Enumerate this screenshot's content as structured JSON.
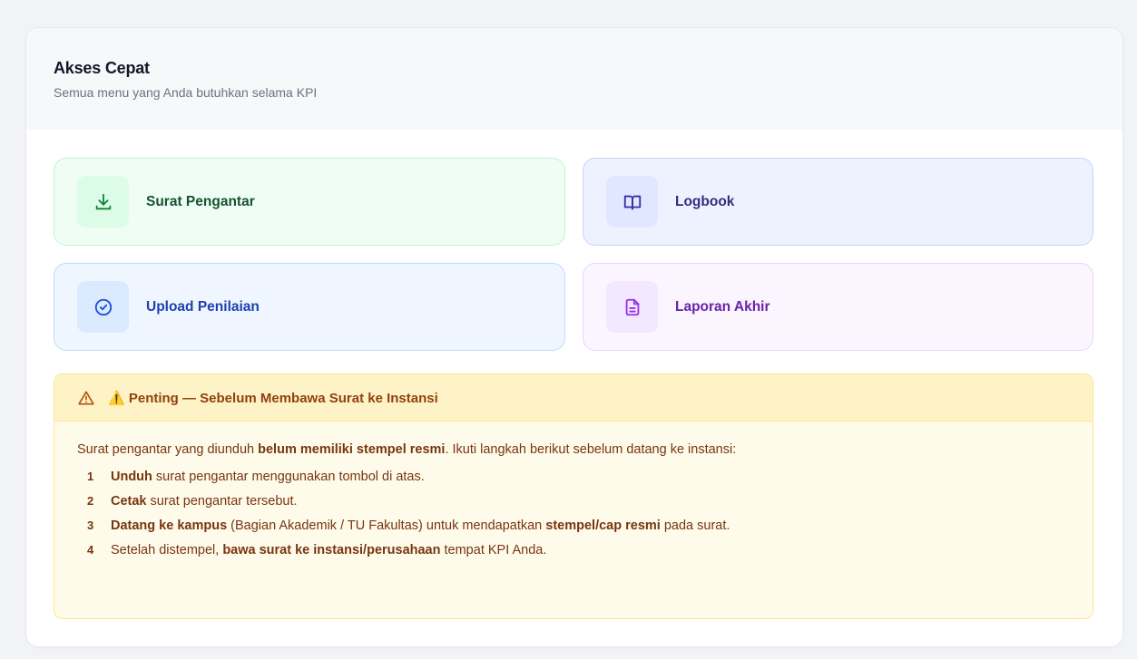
{
  "header": {
    "title": "Akses Cepat",
    "subtitle": "Semua menu yang Anda butuhkan selama KPI"
  },
  "tiles": [
    {
      "label": "Surat Pengantar",
      "icon": "download-icon",
      "color": "#15803d"
    },
    {
      "label": "Logbook",
      "icon": "book-open-icon",
      "color": "#3730a3"
    },
    {
      "label": "Upload Penilaian",
      "icon": "check-circle-icon",
      "color": "#1d4ed8"
    },
    {
      "label": "Laporan Akhir",
      "icon": "file-text-icon",
      "color": "#9333ea"
    }
  ],
  "alert": {
    "title": "⚠️ Penting — Sebelum Membawa Surat ke Instansi",
    "intro": {
      "before": "Surat pengantar yang diunduh ",
      "bold": "belum memiliki stempel resmi",
      "after": ". Ikuti langkah berikut sebelum datang ke instansi:"
    },
    "steps": [
      {
        "num": "1",
        "p1": "",
        "b1": "Unduh",
        "p2": " surat pengantar menggunakan tombol di atas.",
        "b2": "",
        "p3": ""
      },
      {
        "num": "2",
        "p1": "",
        "b1": "Cetak",
        "p2": " surat pengantar tersebut.",
        "b2": "",
        "p3": ""
      },
      {
        "num": "3",
        "p1": "",
        "b1": "Datang ke kampus",
        "p2": " (Bagian Akademik / TU Fakultas) untuk mendapatkan ",
        "b2": "stempel/cap resmi",
        "p3": " pada surat."
      },
      {
        "num": "4",
        "p1": "Setelah distempel, ",
        "b1": "bawa surat ke instansi/perusahaan",
        "p2": " tempat KPI Anda.",
        "b2": "",
        "p3": ""
      }
    ]
  }
}
